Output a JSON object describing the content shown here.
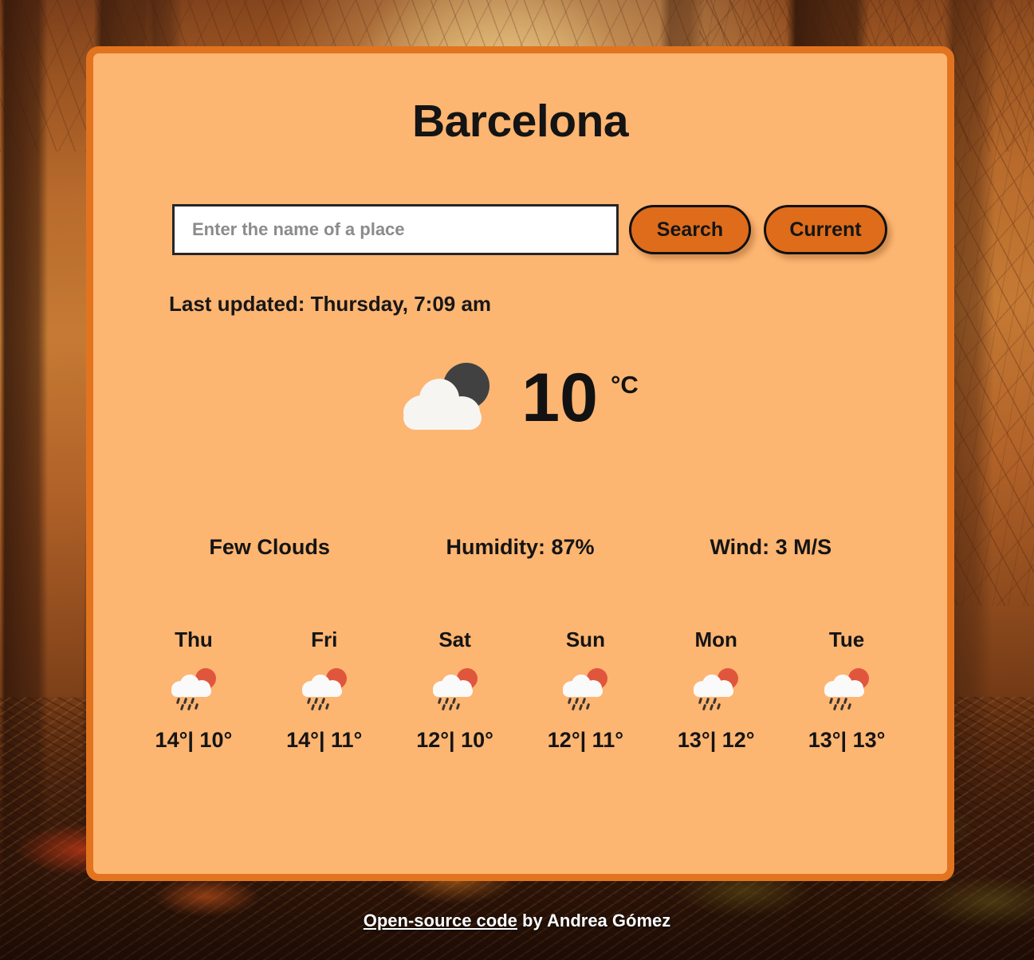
{
  "app": {
    "background_description": "autumn-forest-sunlight-photo",
    "card_bg_color": "#FDB572",
    "card_border_color": "#E2741F",
    "button_color": "#DE6C1B",
    "text_color": "#141414"
  },
  "header": {
    "city": "Barcelona"
  },
  "search": {
    "placeholder": "Enter the name of a place",
    "value": "",
    "search_label": "Search",
    "current_label": "Current"
  },
  "status": {
    "last_updated": "Last updated: Thursday, 7:09 am"
  },
  "current": {
    "icon": "cloud-moon-icon",
    "temperature": "10",
    "unit": "°C",
    "description": "Few Clouds",
    "humidity": "Humidity: 87%",
    "wind": "Wind: 3 M/S"
  },
  "forecast": [
    {
      "day": "Thu",
      "icon": "cloud-sun-rain-icon",
      "temps": "14°| 10°",
      "high": "14°",
      "low": "10°"
    },
    {
      "day": "Fri",
      "icon": "cloud-sun-rain-icon",
      "temps": "14°| 11°",
      "high": "14°",
      "low": "11°"
    },
    {
      "day": "Sat",
      "icon": "cloud-sun-rain-icon",
      "temps": "12°| 10°",
      "high": "12°",
      "low": "10°"
    },
    {
      "day": "Sun",
      "icon": "cloud-sun-rain-icon",
      "temps": "12°| 11°",
      "high": "12°",
      "low": "11°"
    },
    {
      "day": "Mon",
      "icon": "cloud-sun-rain-icon",
      "temps": "13°| 12°",
      "high": "13°",
      "low": "12°"
    },
    {
      "day": "Tue",
      "icon": "cloud-sun-rain-icon",
      "temps": "13°| 13°",
      "high": "13°",
      "low": "13°"
    }
  ],
  "footer": {
    "link_text": "Open-source code",
    "suffix_text": " by Andrea Gómez"
  }
}
